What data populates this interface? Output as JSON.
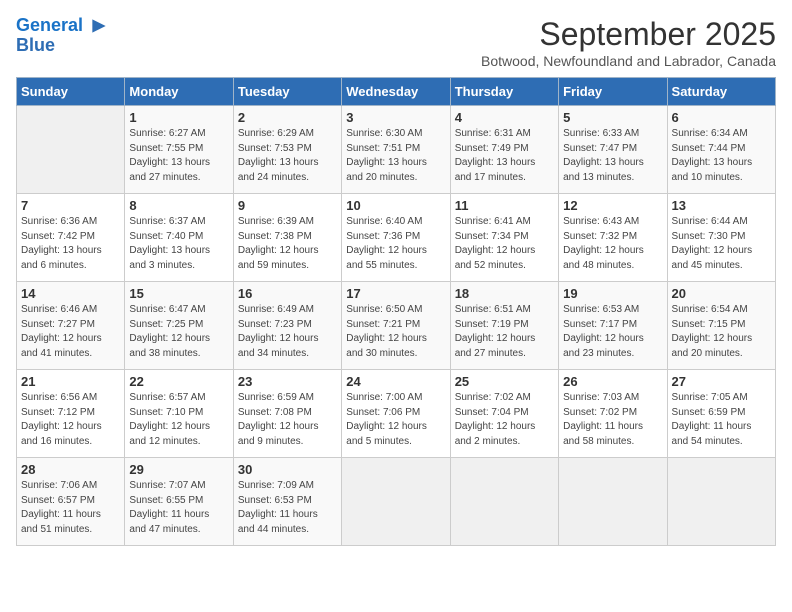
{
  "logo": {
    "line1": "General",
    "line2": "Blue"
  },
  "title": "September 2025",
  "subtitle": "Botwood, Newfoundland and Labrador, Canada",
  "days_of_week": [
    "Sunday",
    "Monday",
    "Tuesday",
    "Wednesday",
    "Thursday",
    "Friday",
    "Saturday"
  ],
  "weeks": [
    [
      {
        "day": "",
        "content": ""
      },
      {
        "day": "1",
        "content": "Sunrise: 6:27 AM\nSunset: 7:55 PM\nDaylight: 13 hours\nand 27 minutes."
      },
      {
        "day": "2",
        "content": "Sunrise: 6:29 AM\nSunset: 7:53 PM\nDaylight: 13 hours\nand 24 minutes."
      },
      {
        "day": "3",
        "content": "Sunrise: 6:30 AM\nSunset: 7:51 PM\nDaylight: 13 hours\nand 20 minutes."
      },
      {
        "day": "4",
        "content": "Sunrise: 6:31 AM\nSunset: 7:49 PM\nDaylight: 13 hours\nand 17 minutes."
      },
      {
        "day": "5",
        "content": "Sunrise: 6:33 AM\nSunset: 7:47 PM\nDaylight: 13 hours\nand 13 minutes."
      },
      {
        "day": "6",
        "content": "Sunrise: 6:34 AM\nSunset: 7:44 PM\nDaylight: 13 hours\nand 10 minutes."
      }
    ],
    [
      {
        "day": "7",
        "content": "Sunrise: 6:36 AM\nSunset: 7:42 PM\nDaylight: 13 hours\nand 6 minutes."
      },
      {
        "day": "8",
        "content": "Sunrise: 6:37 AM\nSunset: 7:40 PM\nDaylight: 13 hours\nand 3 minutes."
      },
      {
        "day": "9",
        "content": "Sunrise: 6:39 AM\nSunset: 7:38 PM\nDaylight: 12 hours\nand 59 minutes."
      },
      {
        "day": "10",
        "content": "Sunrise: 6:40 AM\nSunset: 7:36 PM\nDaylight: 12 hours\nand 55 minutes."
      },
      {
        "day": "11",
        "content": "Sunrise: 6:41 AM\nSunset: 7:34 PM\nDaylight: 12 hours\nand 52 minutes."
      },
      {
        "day": "12",
        "content": "Sunrise: 6:43 AM\nSunset: 7:32 PM\nDaylight: 12 hours\nand 48 minutes."
      },
      {
        "day": "13",
        "content": "Sunrise: 6:44 AM\nSunset: 7:30 PM\nDaylight: 12 hours\nand 45 minutes."
      }
    ],
    [
      {
        "day": "14",
        "content": "Sunrise: 6:46 AM\nSunset: 7:27 PM\nDaylight: 12 hours\nand 41 minutes."
      },
      {
        "day": "15",
        "content": "Sunrise: 6:47 AM\nSunset: 7:25 PM\nDaylight: 12 hours\nand 38 minutes."
      },
      {
        "day": "16",
        "content": "Sunrise: 6:49 AM\nSunset: 7:23 PM\nDaylight: 12 hours\nand 34 minutes."
      },
      {
        "day": "17",
        "content": "Sunrise: 6:50 AM\nSunset: 7:21 PM\nDaylight: 12 hours\nand 30 minutes."
      },
      {
        "day": "18",
        "content": "Sunrise: 6:51 AM\nSunset: 7:19 PM\nDaylight: 12 hours\nand 27 minutes."
      },
      {
        "day": "19",
        "content": "Sunrise: 6:53 AM\nSunset: 7:17 PM\nDaylight: 12 hours\nand 23 minutes."
      },
      {
        "day": "20",
        "content": "Sunrise: 6:54 AM\nSunset: 7:15 PM\nDaylight: 12 hours\nand 20 minutes."
      }
    ],
    [
      {
        "day": "21",
        "content": "Sunrise: 6:56 AM\nSunset: 7:12 PM\nDaylight: 12 hours\nand 16 minutes."
      },
      {
        "day": "22",
        "content": "Sunrise: 6:57 AM\nSunset: 7:10 PM\nDaylight: 12 hours\nand 12 minutes."
      },
      {
        "day": "23",
        "content": "Sunrise: 6:59 AM\nSunset: 7:08 PM\nDaylight: 12 hours\nand 9 minutes."
      },
      {
        "day": "24",
        "content": "Sunrise: 7:00 AM\nSunset: 7:06 PM\nDaylight: 12 hours\nand 5 minutes."
      },
      {
        "day": "25",
        "content": "Sunrise: 7:02 AM\nSunset: 7:04 PM\nDaylight: 12 hours\nand 2 minutes."
      },
      {
        "day": "26",
        "content": "Sunrise: 7:03 AM\nSunset: 7:02 PM\nDaylight: 11 hours\nand 58 minutes."
      },
      {
        "day": "27",
        "content": "Sunrise: 7:05 AM\nSunset: 6:59 PM\nDaylight: 11 hours\nand 54 minutes."
      }
    ],
    [
      {
        "day": "28",
        "content": "Sunrise: 7:06 AM\nSunset: 6:57 PM\nDaylight: 11 hours\nand 51 minutes."
      },
      {
        "day": "29",
        "content": "Sunrise: 7:07 AM\nSunset: 6:55 PM\nDaylight: 11 hours\nand 47 minutes."
      },
      {
        "day": "30",
        "content": "Sunrise: 7:09 AM\nSunset: 6:53 PM\nDaylight: 11 hours\nand 44 minutes."
      },
      {
        "day": "",
        "content": ""
      },
      {
        "day": "",
        "content": ""
      },
      {
        "day": "",
        "content": ""
      },
      {
        "day": "",
        "content": ""
      }
    ]
  ]
}
